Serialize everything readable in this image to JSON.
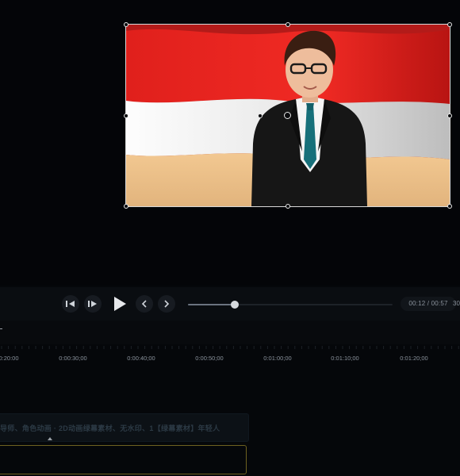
{
  "preview": {
    "media_description_icon": "avatar-presenter-image",
    "flag_colors": {
      "red": "#e31d1d",
      "white": "#f4f4f4",
      "sand": "#e9bd85"
    }
  },
  "player": {
    "prev_frame_icon": "step-back-icon",
    "next_frame_icon": "step-forward-icon",
    "play_icon": "play-icon",
    "prev_clip_icon": "chevron-left-icon",
    "next_clip_icon": "chevron-right-icon",
    "progress_fraction": 0.23,
    "time_current": "00:12",
    "time_separator": "/",
    "time_total": "00:57",
    "time_text": "00:12 / 00:57",
    "zoom_readout": "30"
  },
  "timeline": {
    "ruler_labels": [
      "0:20:00",
      "0:00:30;00",
      "0:00:40;00",
      "0:00:50;00",
      "0:01:00;00",
      "0:01:10;00",
      "0:01:20;00"
    ],
    "clip_title": "导师、角色动画 · 2D动画绿幕素材、无水印、1【绿幕素材】年轻人"
  },
  "colors": {
    "background": "#05070a",
    "selection_border": "#6d6120",
    "seek_thumb": "#d6d9dd"
  }
}
